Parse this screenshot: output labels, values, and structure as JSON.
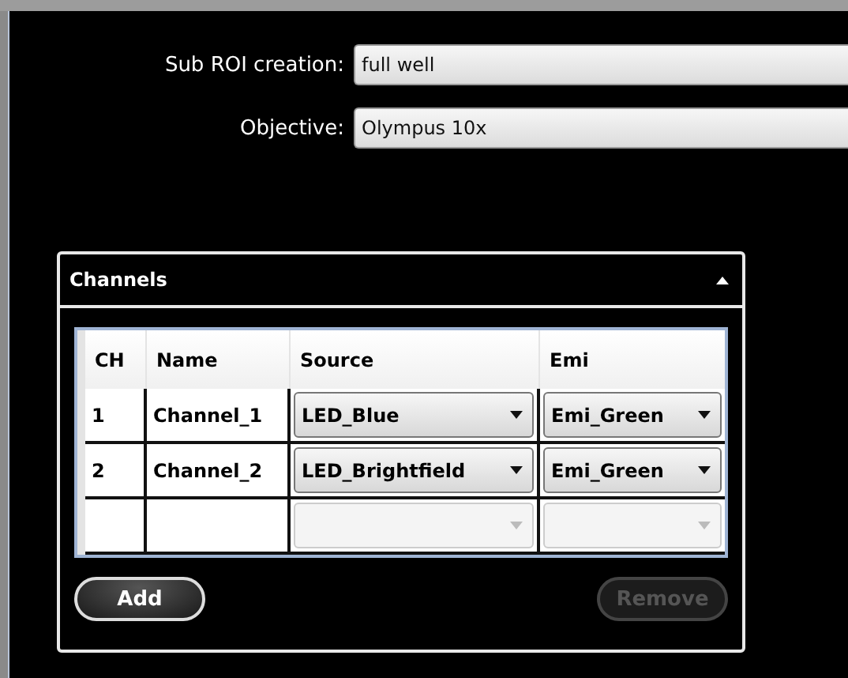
{
  "fields": [
    {
      "label": "Sub ROI creation:",
      "value": "full well"
    },
    {
      "label": "Objective:",
      "value": "Olympus 10x"
    }
  ],
  "channels_panel": {
    "title": "Channels",
    "expanded": true,
    "table": {
      "columns": [
        "CH",
        "Name",
        "Source",
        "Emi"
      ],
      "rows": [
        {
          "ch": "1",
          "name": "Channel_1",
          "source": {
            "value": "LED_Blue",
            "disabled": false
          },
          "emi": {
            "value": "Emi_Green",
            "disabled": false
          }
        },
        {
          "ch": "2",
          "name": "Channel_2",
          "source": {
            "value": "LED_Brightfield",
            "disabled": false
          },
          "emi": {
            "value": "Emi_Green",
            "disabled": false
          }
        },
        {
          "source": {
            "disabled": true
          },
          "emi": {
            "disabled": true
          }
        }
      ]
    },
    "buttons": [
      {
        "label": "Add",
        "disabled": false
      },
      {
        "label": "Remove",
        "disabled": true
      }
    ]
  }
}
